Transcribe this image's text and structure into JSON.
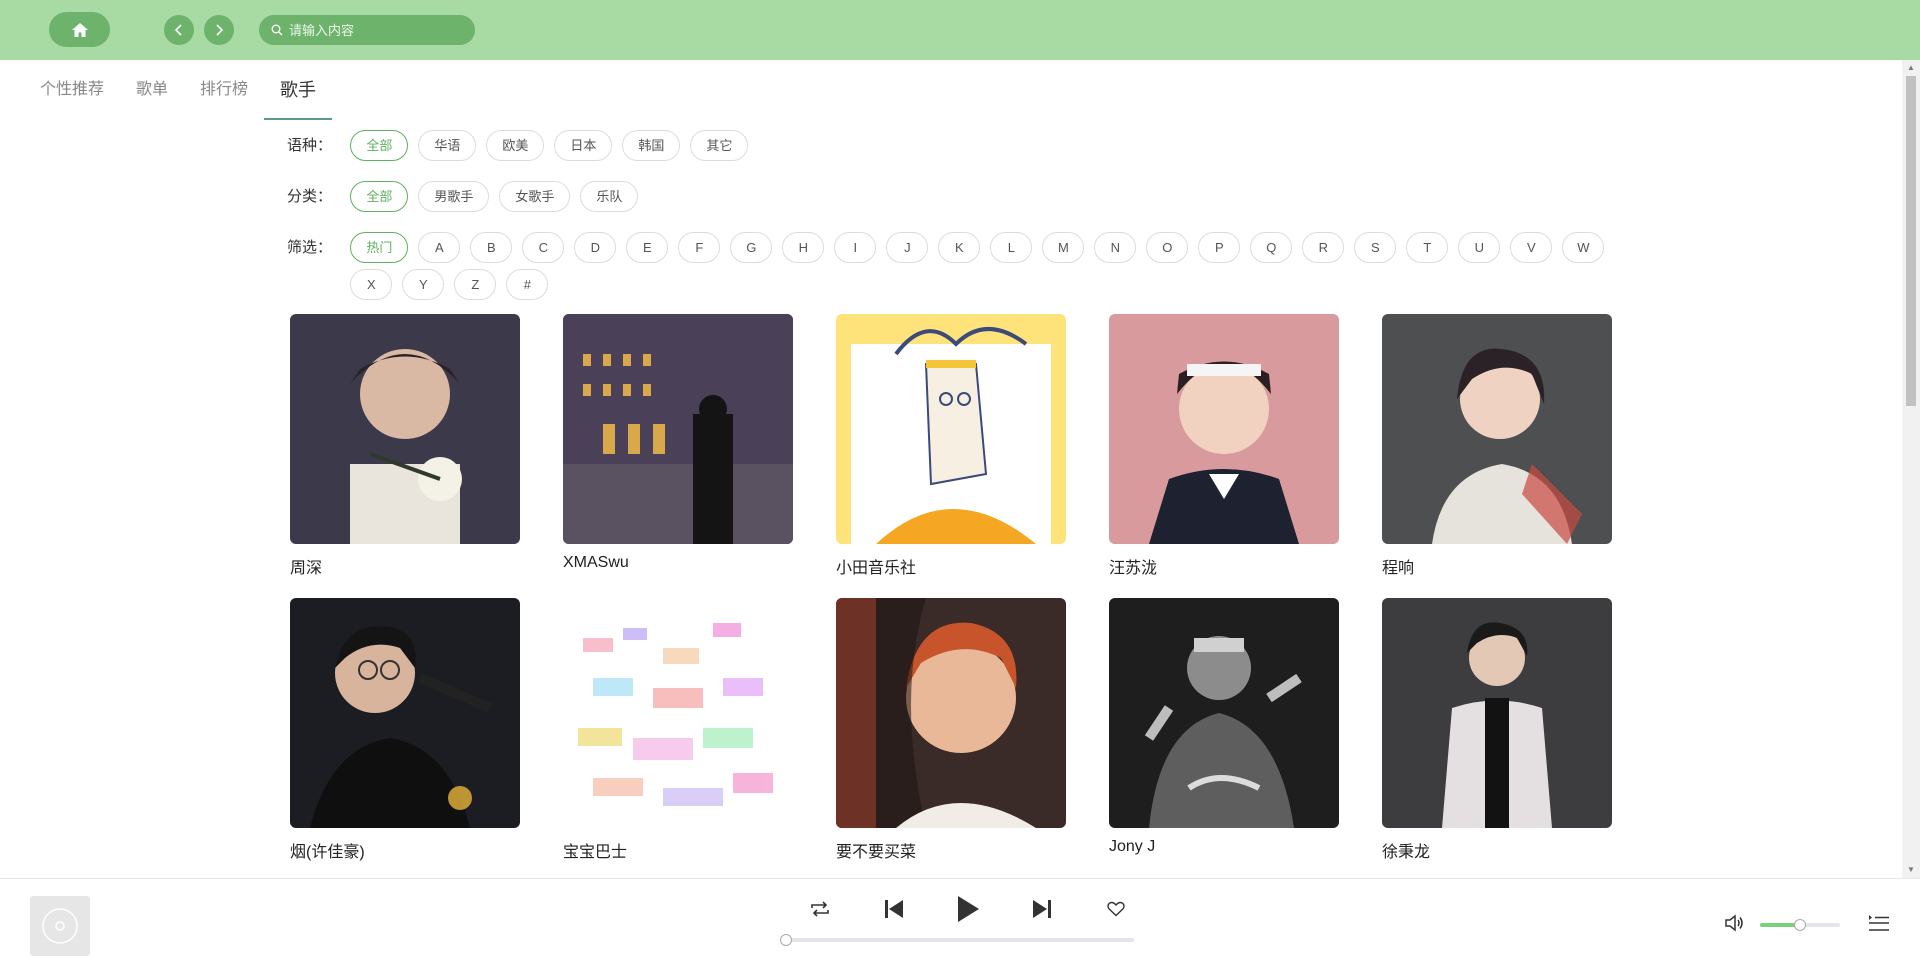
{
  "search": {
    "placeholder": "请输入内容"
  },
  "tabs": [
    {
      "label": "个性推荐"
    },
    {
      "label": "歌单"
    },
    {
      "label": "排行榜"
    },
    {
      "label": "歌手"
    }
  ],
  "filters": {
    "language": {
      "label": "语种：",
      "options": [
        "全部",
        "华语",
        "欧美",
        "日本",
        "韩国",
        "其它"
      ]
    },
    "category": {
      "label": "分类：",
      "options": [
        "全部",
        "男歌手",
        "女歌手",
        "乐队"
      ]
    },
    "initial": {
      "label": "筛选：",
      "options": [
        "热门",
        "A",
        "B",
        "C",
        "D",
        "E",
        "F",
        "G",
        "H",
        "I",
        "J",
        "K",
        "L",
        "M",
        "N",
        "O",
        "P",
        "Q",
        "R",
        "S",
        "T",
        "U",
        "V",
        "W",
        "X",
        "Y",
        "Z",
        "#"
      ]
    }
  },
  "artists": [
    {
      "name": "周深"
    },
    {
      "name": "XMASwu"
    },
    {
      "name": "小田音乐社"
    },
    {
      "name": "汪苏泷"
    },
    {
      "name": "程响"
    },
    {
      "name": "烟(许佳豪)"
    },
    {
      "name": "宝宝巴士"
    },
    {
      "name": "要不要买菜"
    },
    {
      "name": "Jony J"
    },
    {
      "name": "徐秉龙"
    }
  ],
  "player": {
    "progress": 0,
    "volume": 0.5
  },
  "colors": {
    "topbar": "#a8daa4",
    "button": "#6db36b",
    "accent": "#5fb160"
  }
}
